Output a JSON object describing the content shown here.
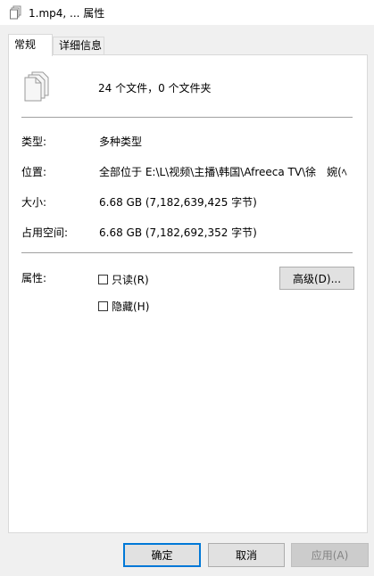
{
  "window": {
    "title": "1.mp4, ... 属性",
    "title_icon": "files-icon"
  },
  "tabs": [
    {
      "label": "常规",
      "active": true
    },
    {
      "label": "详细信息",
      "active": false
    }
  ],
  "general": {
    "summary": "24 个文件，0 个文件夹",
    "summary_icon": "multiple-files-icon",
    "rows": [
      {
        "label": "类型:",
        "value": "多种类型"
      },
      {
        "label": "位置:",
        "value": "全部位于 E:\\L\\视频\\主播\\韩国\\Afreeca TV\\徐　婉(ﾍ"
      },
      {
        "label": "大小:",
        "value": "6.68 GB (7,182,639,425 字节)"
      },
      {
        "label": "占用空间:",
        "value": "6.68 GB (7,182,692,352 字节)"
      }
    ],
    "attributes_label": "属性:",
    "readonly_label": "只读(R)",
    "readonly_checked": false,
    "hidden_label": "隐藏(H)",
    "hidden_checked": false,
    "advanced_label": "高级(D)..."
  },
  "buttons": {
    "ok": "确定",
    "cancel": "取消",
    "apply": "应用(A)",
    "apply_enabled": false
  },
  "colors": {
    "focus_border": "#0078d7",
    "panel_bg": "#ffffff",
    "window_bg": "#f0f0f0"
  }
}
